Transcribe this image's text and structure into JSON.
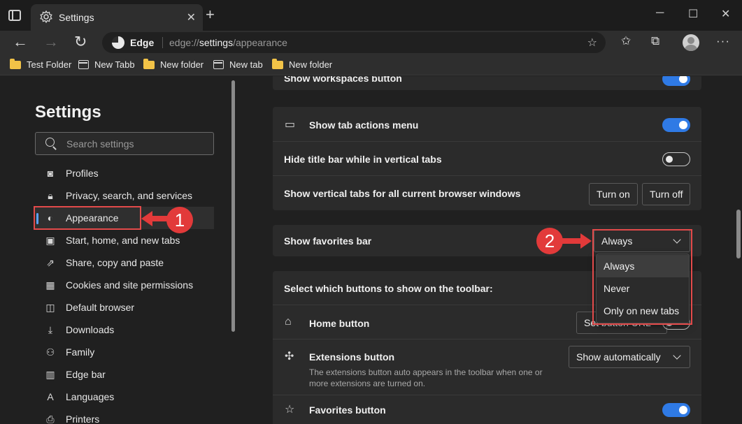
{
  "window": {
    "tab_title": "Settings",
    "tab_close": "✕",
    "new_tab": "+",
    "minimize": "─",
    "maximize": "☐",
    "close": "✕"
  },
  "address_bar": {
    "site_label": "Edge",
    "url_scheme": "edge://",
    "url_host": "settings",
    "url_path": "/appearance"
  },
  "favorites_bar": {
    "items": [
      {
        "label": "Test Folder",
        "icon": "folder-icon"
      },
      {
        "label": "New Tabb",
        "icon": "page-icon"
      },
      {
        "label": "New folder",
        "icon": "folder-icon"
      },
      {
        "label": "New tab",
        "icon": "page-icon"
      },
      {
        "label": "New folder",
        "icon": "folder-icon"
      }
    ]
  },
  "sidebar": {
    "heading": "Settings",
    "search_placeholder": "Search settings",
    "items": [
      {
        "label": "Profiles",
        "icon": "profile-icon"
      },
      {
        "label": "Privacy, search, and services",
        "icon": "lock-icon"
      },
      {
        "label": "Appearance",
        "icon": "palette-icon",
        "active": true
      },
      {
        "label": "Start, home, and new tabs",
        "icon": "home-tabs-icon"
      },
      {
        "label": "Share, copy and paste",
        "icon": "share-icon"
      },
      {
        "label": "Cookies and site permissions",
        "icon": "cookies-icon"
      },
      {
        "label": "Default browser",
        "icon": "browser-icon"
      },
      {
        "label": "Downloads",
        "icon": "download-icon"
      },
      {
        "label": "Family",
        "icon": "family-icon"
      },
      {
        "label": "Edge bar",
        "icon": "edge-bar-icon"
      },
      {
        "label": "Languages",
        "icon": "languages-icon"
      },
      {
        "label": "Printers",
        "icon": "printer-icon"
      }
    ]
  },
  "annotations": {
    "step1": "1",
    "step2": "2",
    "color": "#e23a3a"
  },
  "content": {
    "workspaces_row": "Show workspaces button",
    "tab_actions_menu": "Show tab actions menu",
    "hide_title_bar": "Hide title bar while in vertical tabs",
    "vertical_tabs_all": "Show vertical tabs for all current browser windows",
    "turn_on": "Turn on",
    "turn_off": "Turn off",
    "favorites_bar_label": "Show favorites bar",
    "favorites_bar_value": "Always",
    "favorites_options": [
      "Always",
      "Never",
      "Only on new tabs"
    ],
    "toolbar_section_heading": "Select which buttons to show on the toolbar:",
    "home_button": "Home button",
    "home_set_button": "Set button URL",
    "extensions_button": "Extensions button",
    "extensions_desc": "The extensions button auto appears in the toolbar when one or more extensions are turned on.",
    "extensions_value": "Show automatically",
    "favorites_button": "Favorites button"
  },
  "colors": {
    "accent": "#2f7ae5",
    "background": "#202020",
    "card": "#2b2b2b"
  }
}
